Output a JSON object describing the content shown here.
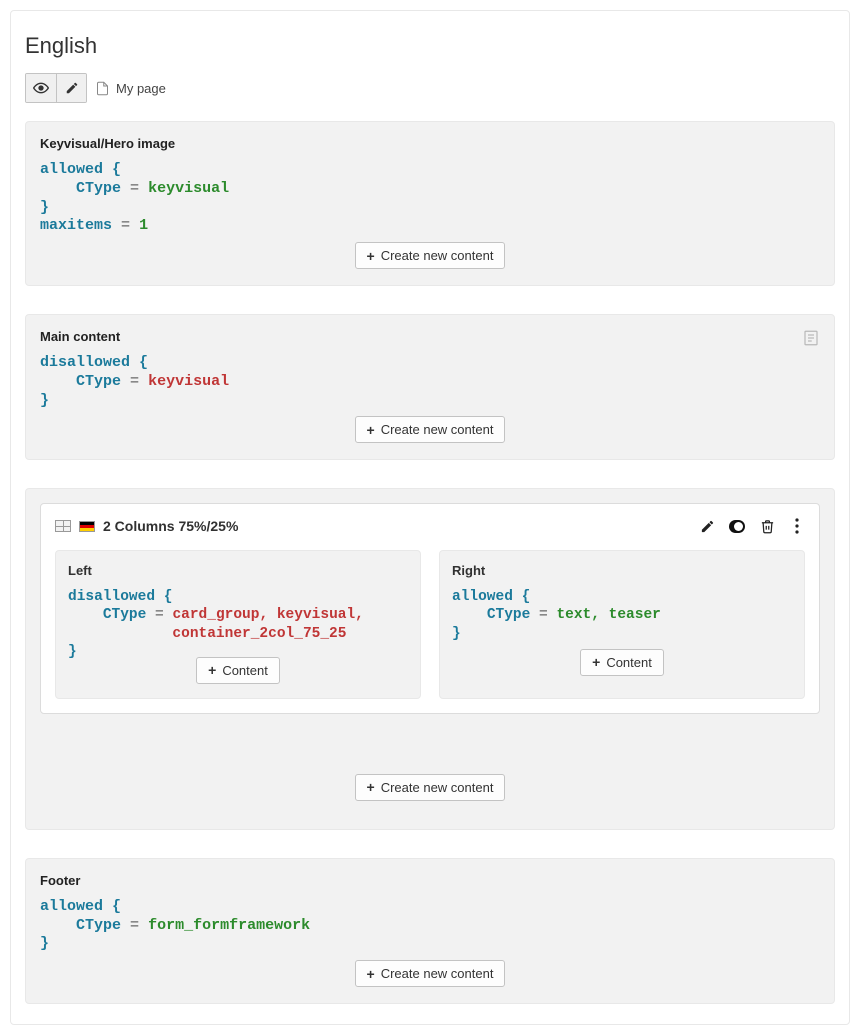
{
  "language_title": "English",
  "page_name": "My page",
  "buttons": {
    "create_new_content": "Create new content",
    "content": "Content"
  },
  "zones": {
    "hero": {
      "title": "Keyvisual/Hero image",
      "mode": "allowed",
      "ctype": "keyvisual",
      "maxitems": 1
    },
    "main": {
      "title": "Main content",
      "mode": "disallowed",
      "ctype": "keyvisual"
    },
    "footer": {
      "title": "Footer",
      "mode": "allowed",
      "ctype": "form_formframework"
    }
  },
  "container": {
    "label": "2 Columns 75%/25%",
    "left": {
      "title": "Left",
      "mode": "disallowed",
      "ctype_line1": "card_group, keyvisual,",
      "ctype_line2": "container_2col_75_25"
    },
    "right": {
      "title": "Right",
      "mode": "allowed",
      "ctype": "text, teaser"
    }
  }
}
